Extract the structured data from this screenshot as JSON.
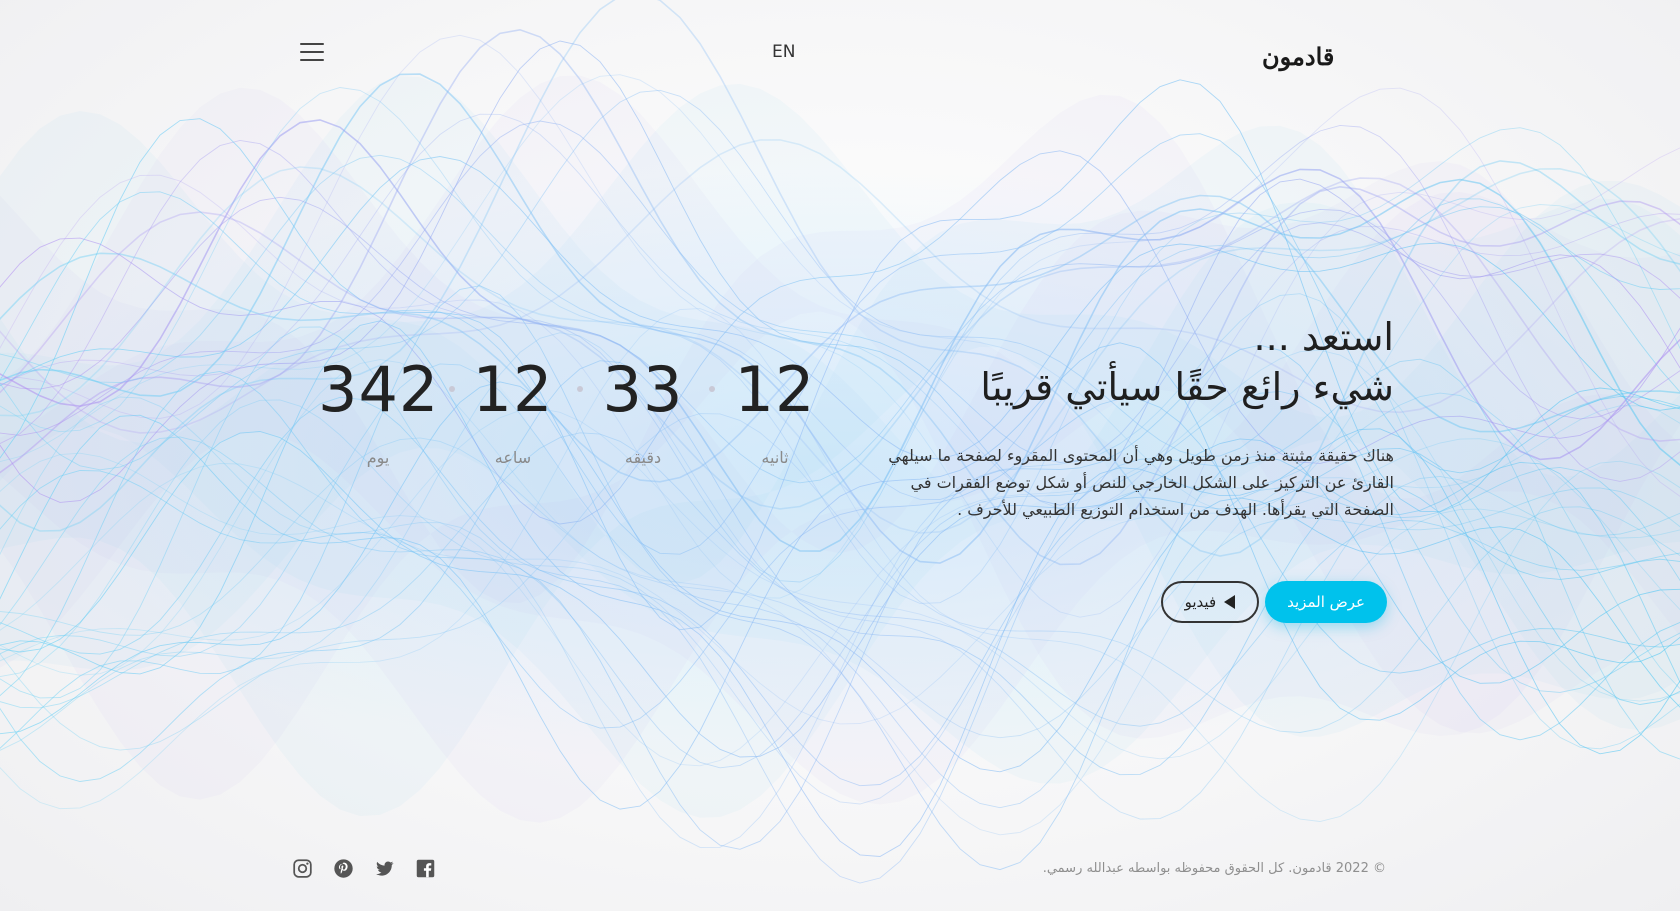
{
  "header": {
    "logo_text": "قادمون",
    "language": "EN",
    "menu_icon": "hamburger-menu-icon"
  },
  "countdown": {
    "items": [
      {
        "value": "342",
        "label": "يوم"
      },
      {
        "value": "12",
        "label": "ساعه"
      },
      {
        "value": "33",
        "label": "دقيقه"
      },
      {
        "value": "12",
        "label": "ثانيه"
      }
    ]
  },
  "hero": {
    "title_line1": "استعد ...",
    "title_line2": "شيء رائع حقًا سيأتي قريبًا",
    "description": "هناك حقيقة مثبتة منذ زمن طويل وهي أن المحتوى المقروء لصفحة ما سيلهي القارئ عن التركيز على الشكل الخارجي للنص أو شكل توضع الفقرات في الصفحة التي يقرأها. الهدف من استخدام التوزيع الطبيعي للأحرف .",
    "primary_button": "عرض المزيد",
    "video_button": "فيديو"
  },
  "footer": {
    "copyright": "© 2022 قادمون. كل الحقوق محفوظه بواسطه عبدالله رسمي.",
    "socials": [
      "instagram-icon",
      "pinterest-icon",
      "twitter-icon",
      "facebook-icon"
    ]
  },
  "colors": {
    "accent": "#00c2ec",
    "wave_blue": "#3fc3f0",
    "wave_purple": "#a98cf0"
  }
}
